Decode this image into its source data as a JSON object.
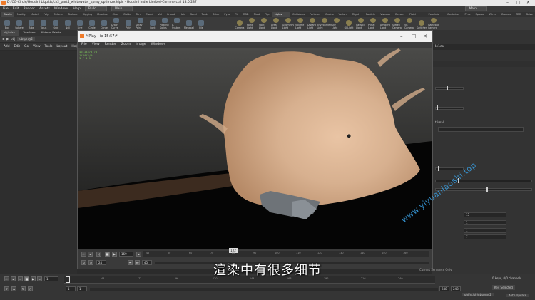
{
  "window_title": "D:/CG-Circle/Houdini Liquids/ch2_part4_whitewater_spray_optimize.hiplc - Houdini Indie Limited-Commercial 18.0.287",
  "main_menu": [
    "File",
    "Edit",
    "Render",
    "Assets",
    "Windows",
    "Help"
  ],
  "desktop_menu": "Build",
  "desktop_main": "Main",
  "right_desktop": "Main",
  "shelf_tabs": [
    "Create",
    "Modify",
    "Model",
    "Poly",
    "Deform",
    "Texture",
    "Rigging",
    "Muscles",
    "Char",
    "Guide",
    "Terr",
    "Cloud",
    "Vol",
    "Crowd",
    "Hair",
    "Sand",
    "Tank",
    "Drive",
    "Pyro",
    "FX",
    "RBD",
    "Fluid",
    "Flip",
    "Lights and Cameras",
    "Collisions",
    "Particles",
    "Grains",
    "Vellum",
    "Rigid Bodies",
    "Particle Fluids",
    "Viscous Fluids",
    "Oceans",
    "Fluid Containers",
    "Populate Containers",
    "Container Tools",
    "Pyro FX",
    "Sparse Pyro",
    "Wires",
    "Crowds",
    "TDR",
    "Drive Sim"
  ],
  "shelf_tools_left": [
    "Box",
    "Sphere",
    "Tube",
    "Torus",
    "Grid",
    "Null",
    "Line",
    "Circle",
    "Curve",
    "Draw Curve",
    "Path",
    "Spray Paint",
    "Font",
    "Platonic Solids",
    "L-System",
    "Metaball",
    "File"
  ],
  "shelf_tools_lights": [
    "Camera",
    "Point Light",
    "Spot Light",
    "Area Light",
    "Geometry Light",
    "Volume Light",
    "Distant Light",
    "Environment Light",
    "Sky Light",
    "GI Light",
    "Caustic Light",
    "Portal Light",
    "Ambient Light",
    "Stereo Camera",
    "VR Camera",
    "Switcher",
    "Gamepad Camera"
  ],
  "left_tabs": [
    "obj/sc/sh...",
    "Tree View",
    "Material Palette",
    "Material Palette"
  ],
  "left_path": "obj",
  "left_node": "ubspray2",
  "left_menu": [
    "Add",
    "Edit",
    "Go",
    "View",
    "Tools",
    "Layout",
    "Help"
  ],
  "right_label": "le1dx",
  "right_text_1": "trimal",
  "right_values": [
    "15",
    "1",
    "1",
    "7"
  ],
  "mplay": {
    "title": "MPlay - ip-15:57:*",
    "menu": [
      "File",
      "View",
      "Render",
      "Zoom",
      "Image",
      "Windows"
    ],
    "render_info": [
      "ip-153/57/8",
      "1/34/3/54",
      "1 / 1 1"
    ],
    "frame_marker": "122",
    "frame_field": "169",
    "start_field": "24",
    "end_field": "45",
    "ruler_ticks": [
      "45",
      "50",
      "60",
      "70",
      "80",
      "90",
      "100",
      "110",
      "120",
      "130",
      "140",
      "150",
      "160"
    ]
  },
  "timeline": {
    "frame": "1",
    "start": "1",
    "start2": "1",
    "end": "248",
    "end2": "248",
    "ticks": [
      "48",
      "72",
      "96",
      "120",
      "144",
      "168",
      "192",
      "216",
      "240"
    ],
    "status": "0 keys, 0/0 channels",
    "key_status": "Key Selected",
    "auto_update": "Auto Update",
    "path_chip": "obj/sc/sh/ubspray2",
    "render_note": "Current Sentence Only"
  },
  "subtitle": "渲染中有很多细节",
  "watermark": "www.yiyuanlaoshi.top"
}
